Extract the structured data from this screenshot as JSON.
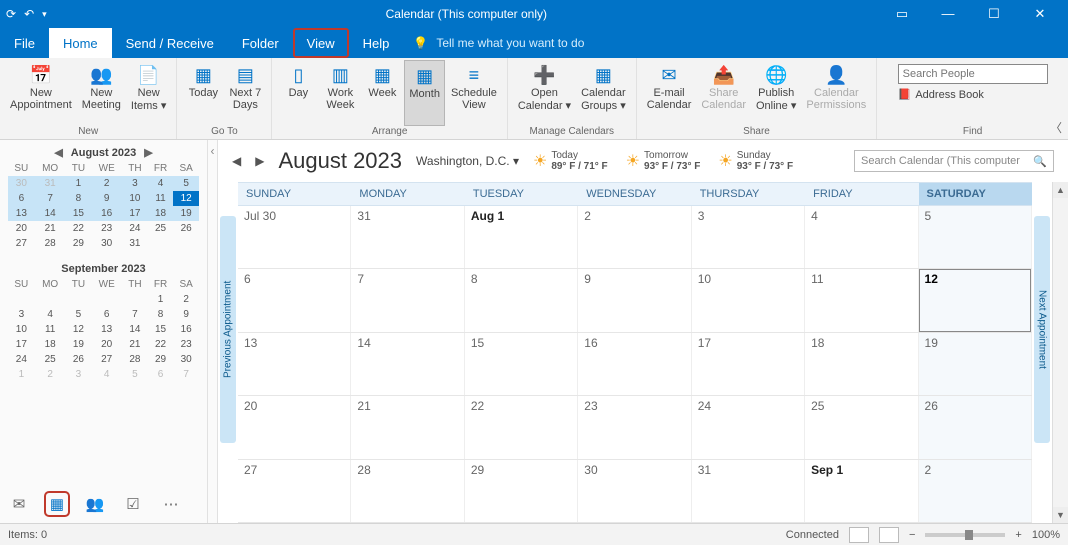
{
  "title": "Calendar (This computer only)",
  "tabs": [
    "File",
    "Home",
    "Send / Receive",
    "Folder",
    "View",
    "Help"
  ],
  "tellme": "Tell me what you want to do",
  "ribbon": {
    "new": {
      "label": "New",
      "items": [
        "New\nAppointment",
        "New\nMeeting",
        "New\nItems ▾"
      ]
    },
    "goto": {
      "label": "Go To",
      "items": [
        "Today",
        "Next 7\nDays"
      ]
    },
    "arrange": {
      "label": "Arrange",
      "items": [
        "Day",
        "Work\nWeek",
        "Week",
        "Month",
        "Schedule\nView"
      ]
    },
    "manage": {
      "label": "Manage Calendars",
      "items": [
        "Open\nCalendar ▾",
        "Calendar\nGroups ▾"
      ]
    },
    "share": {
      "label": "Share",
      "items": [
        "E-mail\nCalendar",
        "Share\nCalendar",
        "Publish\nOnline ▾",
        "Calendar\nPermissions"
      ]
    },
    "find": {
      "label": "Find",
      "search_placeholder": "Search People",
      "address_book": "Address Book"
    }
  },
  "minical1": {
    "title": "August 2023",
    "dow": [
      "SU",
      "MO",
      "TU",
      "WE",
      "TH",
      "FR",
      "SA"
    ],
    "rows": [
      [
        "30",
        "31",
        "1",
        "2",
        "3",
        "4",
        "5"
      ],
      [
        "6",
        "7",
        "8",
        "9",
        "10",
        "11",
        "12"
      ],
      [
        "13",
        "14",
        "15",
        "16",
        "17",
        "18",
        "19"
      ],
      [
        "20",
        "21",
        "22",
        "23",
        "24",
        "25",
        "26"
      ],
      [
        "27",
        "28",
        "29",
        "30",
        "31",
        "",
        ""
      ]
    ]
  },
  "minical2": {
    "title": "September 2023",
    "dow": [
      "SU",
      "MO",
      "TU",
      "WE",
      "TH",
      "FR",
      "SA"
    ],
    "rows": [
      [
        "",
        "",
        "",
        "",
        "",
        "1",
        "2"
      ],
      [
        "3",
        "4",
        "5",
        "6",
        "7",
        "8",
        "9"
      ],
      [
        "10",
        "11",
        "12",
        "13",
        "14",
        "15",
        "16"
      ],
      [
        "17",
        "18",
        "19",
        "20",
        "21",
        "22",
        "23"
      ],
      [
        "24",
        "25",
        "26",
        "27",
        "28",
        "29",
        "30"
      ],
      [
        "1",
        "2",
        "3",
        "4",
        "5",
        "6",
        "7"
      ]
    ]
  },
  "header": {
    "month": "August 2023",
    "location": "Washington,  D.C.  ▾",
    "weather": [
      {
        "label": "Today",
        "temp": "89° F / 71° F"
      },
      {
        "label": "Tomorrow",
        "temp": "93° F / 73° F"
      },
      {
        "label": "Sunday",
        "temp": "93° F / 73° F"
      }
    ],
    "search_placeholder": "Search Calendar (This computer"
  },
  "days": [
    "SUNDAY",
    "MONDAY",
    "TUESDAY",
    "WEDNESDAY",
    "THURSDAY",
    "FRIDAY",
    "SATURDAY"
  ],
  "weeks": [
    [
      "Jul 30",
      "31",
      "Aug 1",
      "2",
      "3",
      "4",
      "5"
    ],
    [
      "6",
      "7",
      "8",
      "9",
      "10",
      "11",
      "12"
    ],
    [
      "13",
      "14",
      "15",
      "16",
      "17",
      "18",
      "19"
    ],
    [
      "20",
      "21",
      "22",
      "23",
      "24",
      "25",
      "26"
    ],
    [
      "27",
      "28",
      "29",
      "30",
      "31",
      "Sep 1",
      "2"
    ]
  ],
  "sidetabs": {
    "prev": "Previous Appointment",
    "next": "Next Appointment"
  },
  "status": {
    "items": "Items: 0",
    "connected": "Connected",
    "zoom": "100%"
  }
}
